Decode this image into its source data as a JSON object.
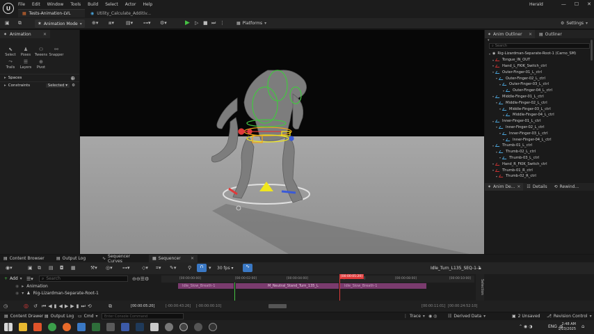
{
  "titlebar": {
    "menu": [
      "File",
      "Edit",
      "Window",
      "Tools",
      "Build",
      "Select",
      "Actor",
      "Help"
    ],
    "tabs": [
      "Tests-Animation-LVL",
      "Utility_Calculate_Additiv..."
    ],
    "user": "Herald",
    "min": "—",
    "max": "☐",
    "close": "✕"
  },
  "toolbar": {
    "mode": "Animation Mode",
    "platforms": "Platforms",
    "settings": "Settings"
  },
  "left_panel": {
    "tab": "Animation",
    "tools": [
      {
        "label": "Select",
        "icon": "cursor-icon"
      },
      {
        "label": "Poses",
        "icon": "poses-icon"
      },
      {
        "label": "Tweens",
        "icon": "tweens-icon"
      },
      {
        "label": "Snapper",
        "icon": "snapper-icon"
      },
      {
        "label": "Trails",
        "icon": "trails-icon"
      },
      {
        "label": "Layers",
        "icon": "layers-icon"
      },
      {
        "label": "Pivot",
        "icon": "pivot-icon"
      }
    ],
    "spaces": "Spaces",
    "constraints": "Constraints",
    "constraints_value": "Selected"
  },
  "outliner": {
    "tab1": "Anim Outliner",
    "tab2": "Outliner",
    "search_placeholder": "Search",
    "items": [
      {
        "label": "Rig-Lizardman-Separate-Root-1 (Carno_SM)",
        "indent": 0,
        "kind": "root"
      },
      {
        "label": "Tongue_IN_OUT",
        "indent": 1,
        "kind": "red"
      },
      {
        "label": "Hand_L_FKIK_Switch_ctrl",
        "indent": 1,
        "kind": "red"
      },
      {
        "label": "Outer-Finger-01_L_ctrl",
        "indent": 1,
        "kind": "blue"
      },
      {
        "label": "Outer-Finger-02_L_ctrl",
        "indent": 2,
        "kind": "blue"
      },
      {
        "label": "Outer-Finger-03_L_ctrl",
        "indent": 3,
        "kind": "blue"
      },
      {
        "label": "Outer-Finger-04_L_ctrl",
        "indent": 4,
        "kind": "blue"
      },
      {
        "label": "Middle-Finger-01_L_ctrl",
        "indent": 1,
        "kind": "blue"
      },
      {
        "label": "Middle-Finger-02_L_ctrl",
        "indent": 2,
        "kind": "blue"
      },
      {
        "label": "Middle-Finger-03_L_ctrl",
        "indent": 3,
        "kind": "blue"
      },
      {
        "label": "Middle-Finger-04_L_ctrl",
        "indent": 4,
        "kind": "blue"
      },
      {
        "label": "Inner-Finger-01_L_ctrl",
        "indent": 1,
        "kind": "blue"
      },
      {
        "label": "Inner-Finger-02_L_ctrl",
        "indent": 2,
        "kind": "blue"
      },
      {
        "label": "Inner-Finger-03_L_ctrl",
        "indent": 3,
        "kind": "blue"
      },
      {
        "label": "Inner-Finger-04_L_ctrl",
        "indent": 4,
        "kind": "blue"
      },
      {
        "label": "Thumb-01_L_ctrl",
        "indent": 1,
        "kind": "blue"
      },
      {
        "label": "Thumb-02_L_ctrl",
        "indent": 2,
        "kind": "blue"
      },
      {
        "label": "Thumb-03_L_ctrl",
        "indent": 3,
        "kind": "blue"
      },
      {
        "label": "Hand_R_FKIK_Switch_ctrl",
        "indent": 1,
        "kind": "red"
      },
      {
        "label": "Thumb-01_R_ctrl",
        "indent": 1,
        "kind": "red"
      },
      {
        "label": "Thumb-02_R_ctrl",
        "indent": 2,
        "kind": "red"
      }
    ]
  },
  "details": {
    "tab1": "Anim De...",
    "tab2": "Details",
    "tab3": "Rewind..."
  },
  "bottom_tabs": [
    "Content Browser",
    "Output Log",
    "Sequencer Curves",
    "Sequencer"
  ],
  "sequencer": {
    "fps": "30 fps",
    "sequence_name": "Idle_Turn_L135_SEQ-1-1",
    "add": "Add",
    "search_placeholder": "Search",
    "tracks": [
      "Animation",
      "Rig-Lizardman-Separate-Root-1"
    ],
    "ruler": [
      "[00:00:00:00]",
      "[00:00:02:00]",
      "[00:00:04:00]",
      "[00:00:06:00]",
      "[00:00:08:00]",
      "[00:00:10:00]"
    ],
    "playhead": "[00:00:05:20]",
    "clips": [
      "Idle_Slow_Breath-1",
      "M_Neutral_Stand_Turn_135_L",
      "Idle_Slow_Breath-1"
    ],
    "current_time": "[00:00:05:20]",
    "start_time": "[-00:00:43:26]",
    "start_time2": "[-00:00:00:10]",
    "end_time": "[00:00:11:01]",
    "end_time2": "[00:00:24:52:10]",
    "selection": "Selection"
  },
  "statusbar": {
    "content_drawer": "Content Drawer",
    "output_log": "Output Log",
    "cmd": "Cmd",
    "console_placeholder": "Enter Console Command",
    "trace": "Trace",
    "derived_data": "Derived Data",
    "unsaved": "2 Unsaved",
    "revision": "Revision Control"
  },
  "taskbar": {
    "lang": "ENG",
    "time": "2:48 AM",
    "date": "1/23/2025"
  },
  "colors": {
    "accent": "#3a78c4",
    "play_green": "#46c244",
    "playhead_red": "#e03a3a",
    "clip_purple": "#7a3b6e"
  }
}
